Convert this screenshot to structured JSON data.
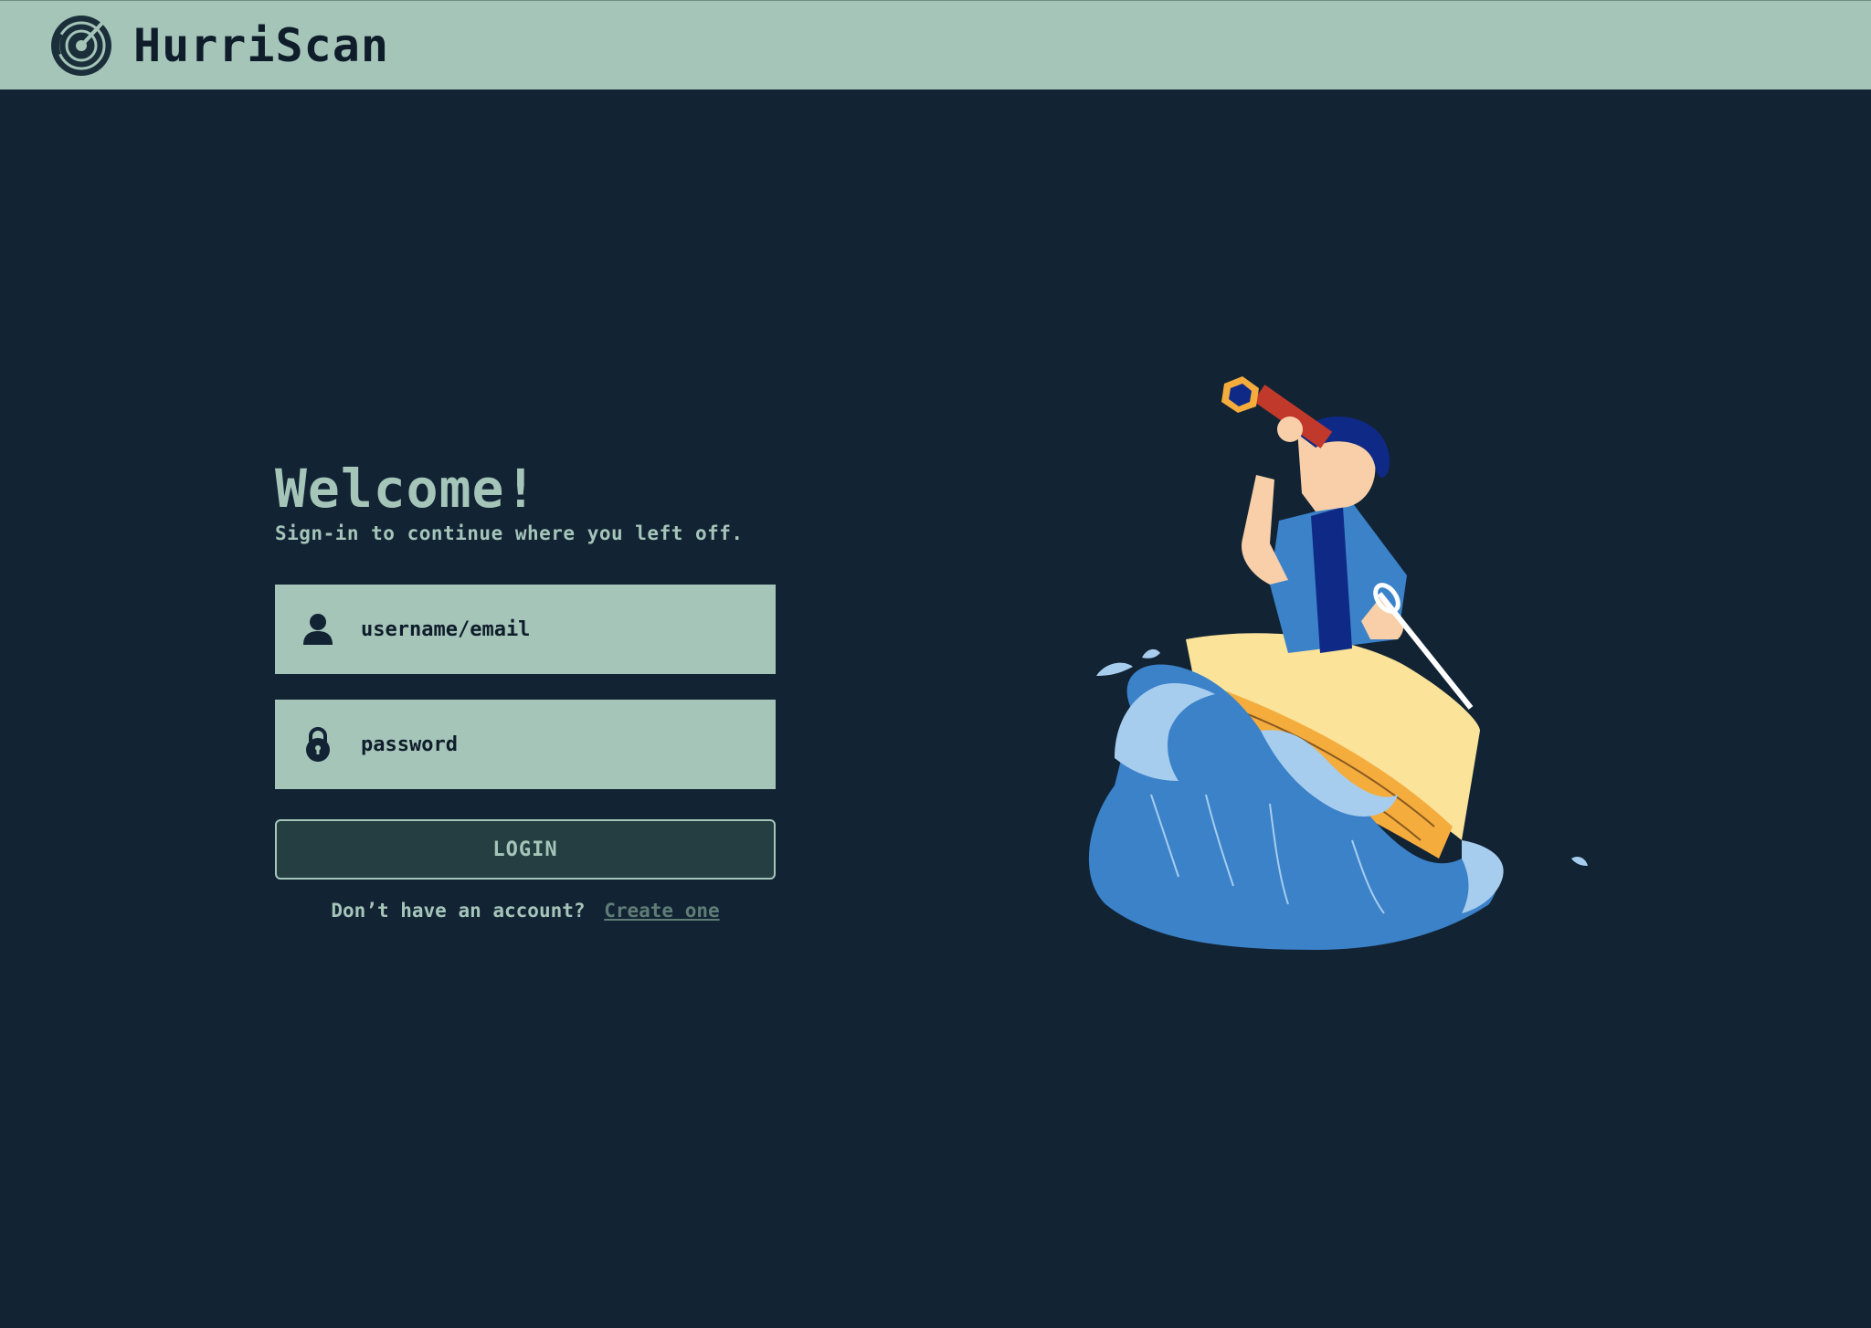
{
  "header": {
    "brand_name": "HurriScan",
    "logo_icon": "radar-icon"
  },
  "login": {
    "title": "Welcome!",
    "subtitle": "Sign-in to continue where you left off.",
    "username": {
      "placeholder": "username/email",
      "value": "",
      "icon": "user-icon"
    },
    "password": {
      "placeholder": "password",
      "value": "",
      "icon": "lock-icon"
    },
    "submit_label": "LOGIN",
    "signup_prompt": "Don’t have an account?",
    "signup_link": "Create one"
  },
  "illustration": {
    "subject": "sailor-with-spyglass-in-boat-on-wave"
  },
  "colors": {
    "background": "#122334",
    "accent": "#a5c5b9",
    "button": "#243e42",
    "link": "#5f7d76",
    "text_dark": "#0f1d2b"
  }
}
